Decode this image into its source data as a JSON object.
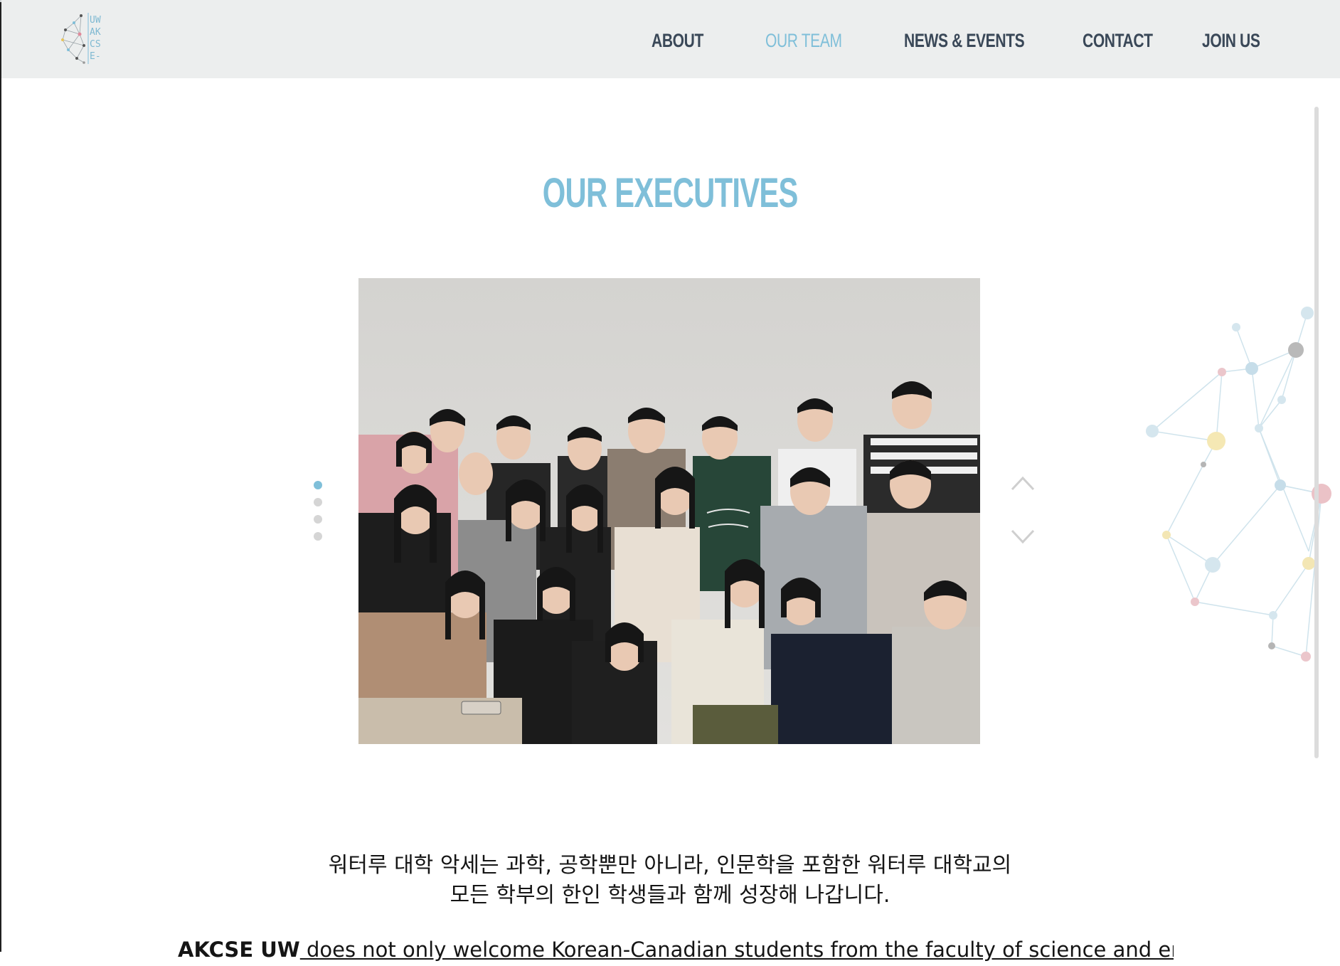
{
  "logo": {
    "letters": [
      "UW",
      "AK",
      "CS",
      "E-"
    ]
  },
  "nav": {
    "about": "ABOUT",
    "our_team": "OUR TEAM",
    "news_events": "NEWS & EVENTS",
    "contact": "CONTACT",
    "join_us": "JOIN US"
  },
  "section": {
    "title": "OUR EXECUTIVES"
  },
  "carousel": {
    "slide_count": 4,
    "active_slide": 1
  },
  "intro": {
    "korean_line1": "워터루 대학 악세는 과학, 공학뿐만 아니라, 인문학을 포함한 워터루 대학교의",
    "korean_line2": "모든 학부의 한인 학생들과 함께 성장해 나갑니다.",
    "english_bold": "AKCSE UW",
    "english_rest": " does not only welcome Korean-Canadian students from the faculty of science and engineering"
  },
  "colors": {
    "accent": "#7fbfd9",
    "nav_text": "#3a4858",
    "header_bg": "#eceeee"
  }
}
